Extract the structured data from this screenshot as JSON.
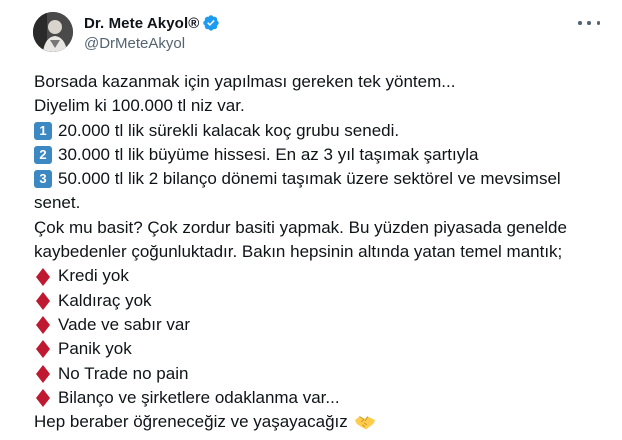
{
  "author": {
    "display_name": "Dr. Mete Akyol®",
    "handle": "@DrMeteAkyol",
    "verified": true,
    "avatar_icon": "profile-photo"
  },
  "menu_icon": "more-options-icon",
  "post": {
    "intro": "Borsada kazanmak için yapılması gereken tek yöntem...",
    "premise": "Diyelim ki 100.000 tl niz var.",
    "steps": [
      {
        "badge": "1",
        "text": "20.000 tl lik sürekli kalacak koç grubu senedi."
      },
      {
        "badge": "2",
        "text": "30.000 tl lik büyüme hissesi. En az 3 yıl taşımak şartıyla"
      },
      {
        "badge": "3",
        "text": "50.000 tl lik 2 bilanço dönemi taşımak üzere sektörel ve mevsimsel"
      }
    ],
    "step3_continuation": "senet.",
    "para_line1": "Çok mu basit? Çok zordur basiti yapmak. Bu yüzden piyasada genelde",
    "para_line2": "kaybedenler çoğunluktadır. Bakın hepsinin altında yatan temel mantık;",
    "principles": [
      "Kredi yok",
      "Kaldıraç yok",
      "Vade ve sabır var",
      "Panik yok",
      "No Trade no pain",
      "Bilanço ve şirketlere odaklanma var..."
    ],
    "closing": "Hep beraber öğreneceğiz ve yaşayacağız"
  },
  "colors": {
    "text": "#0f1419",
    "muted": "#536471",
    "verified_blue": "#1d9bf0",
    "keycap_blue": "#3b88c3",
    "diamond_red": "#be1931"
  }
}
